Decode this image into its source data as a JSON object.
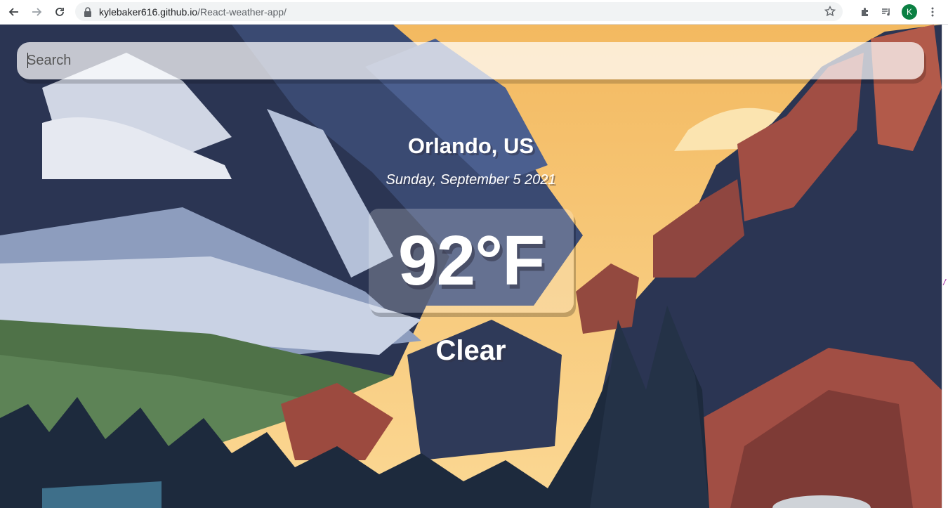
{
  "browser": {
    "url_host": "kylebaker616.github.io",
    "url_path": "/React-weather-app/",
    "profile_initial": "K",
    "profile_color": "#0b8043",
    "icons": [
      "back-icon",
      "forward-icon",
      "reload-icon",
      "lock-icon",
      "star-icon",
      "extensions-icon",
      "media-icon",
      "more-icon"
    ]
  },
  "app": {
    "search_placeholder": "Search",
    "location": "Orlando, US",
    "date": "Sunday, September 5 2021",
    "temperature": "92°F",
    "weather": "Clear"
  },
  "edge": {
    "glyph": "/"
  },
  "colors": {
    "sky": "#f7c77a",
    "mountain_dark": "#2b3553",
    "rock_red": "#a14e44",
    "snow": "#cfd6e6",
    "forest": "#1d2a3d"
  }
}
